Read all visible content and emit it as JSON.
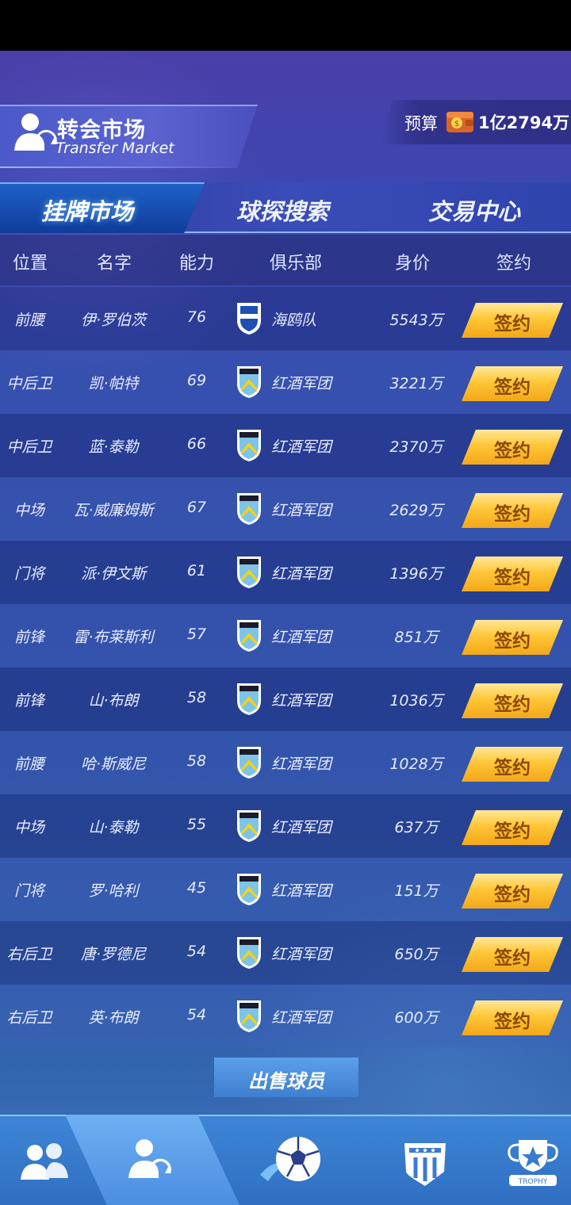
{
  "header": {
    "title_cn": "转会市场",
    "title_en": "Transfer Market",
    "budget_label": "预算",
    "budget_value": "1亿2794万"
  },
  "tabs": [
    {
      "label": "挂牌市场",
      "active": true
    },
    {
      "label": "球探搜索",
      "active": false
    },
    {
      "label": "交易中心",
      "active": false
    }
  ],
  "table": {
    "columns": [
      "位置",
      "名字",
      "能力",
      "俱乐部",
      "身价",
      "签约"
    ],
    "rows": [
      {
        "pos": "前腰",
        "name": "伊·罗伯茨",
        "ability": "76",
        "club": "海鸥队",
        "value": "5543万",
        "action": "签约",
        "crest": "seagulls"
      },
      {
        "pos": "中后卫",
        "name": "凯·帕特",
        "ability": "69",
        "club": "红酒军团",
        "value": "3221万",
        "action": "签约",
        "crest": "wine"
      },
      {
        "pos": "中后卫",
        "name": "蓝·泰勒",
        "ability": "66",
        "club": "红酒军团",
        "value": "2370万",
        "action": "签约",
        "crest": "wine"
      },
      {
        "pos": "中场",
        "name": "瓦·威廉姆斯",
        "ability": "67",
        "club": "红酒军团",
        "value": "2629万",
        "action": "签约",
        "crest": "wine"
      },
      {
        "pos": "门将",
        "name": "派·伊文斯",
        "ability": "61",
        "club": "红酒军团",
        "value": "1396万",
        "action": "签约",
        "crest": "wine"
      },
      {
        "pos": "前锋",
        "name": "雷·布莱斯利",
        "ability": "57",
        "club": "红酒军团",
        "value": "851万",
        "action": "签约",
        "crest": "wine"
      },
      {
        "pos": "前锋",
        "name": "山·布朗",
        "ability": "58",
        "club": "红酒军团",
        "value": "1036万",
        "action": "签约",
        "crest": "wine"
      },
      {
        "pos": "前腰",
        "name": "哈·斯威尼",
        "ability": "58",
        "club": "红酒军团",
        "value": "1028万",
        "action": "签约",
        "crest": "wine"
      },
      {
        "pos": "中场",
        "name": "山·泰勒",
        "ability": "55",
        "club": "红酒军团",
        "value": "637万",
        "action": "签约",
        "crest": "wine"
      },
      {
        "pos": "门将",
        "name": "罗·哈利",
        "ability": "45",
        "club": "红酒军团",
        "value": "151万",
        "action": "签约",
        "crest": "wine"
      },
      {
        "pos": "右后卫",
        "name": "唐·罗德尼",
        "ability": "54",
        "club": "红酒军团",
        "value": "650万",
        "action": "签约",
        "crest": "wine"
      },
      {
        "pos": "右后卫",
        "name": "英·布朗",
        "ability": "54",
        "club": "红酒军团",
        "value": "600万",
        "action": "签约",
        "crest": "wine"
      }
    ]
  },
  "sell_button": "出售球员",
  "bottom_nav": [
    {
      "icon": "team-icon",
      "active": false
    },
    {
      "icon": "transfer-icon",
      "active": true
    },
    {
      "icon": "soccer-ball-icon",
      "active": false
    },
    {
      "icon": "club-shield-icon",
      "active": false
    },
    {
      "icon": "trophy-icon",
      "active": false,
      "label": "TROPHY"
    }
  ],
  "colors": {
    "sign_button": "#ffc637",
    "active_tab": "#1f62c7",
    "nav_bar": "#3e85d6"
  }
}
